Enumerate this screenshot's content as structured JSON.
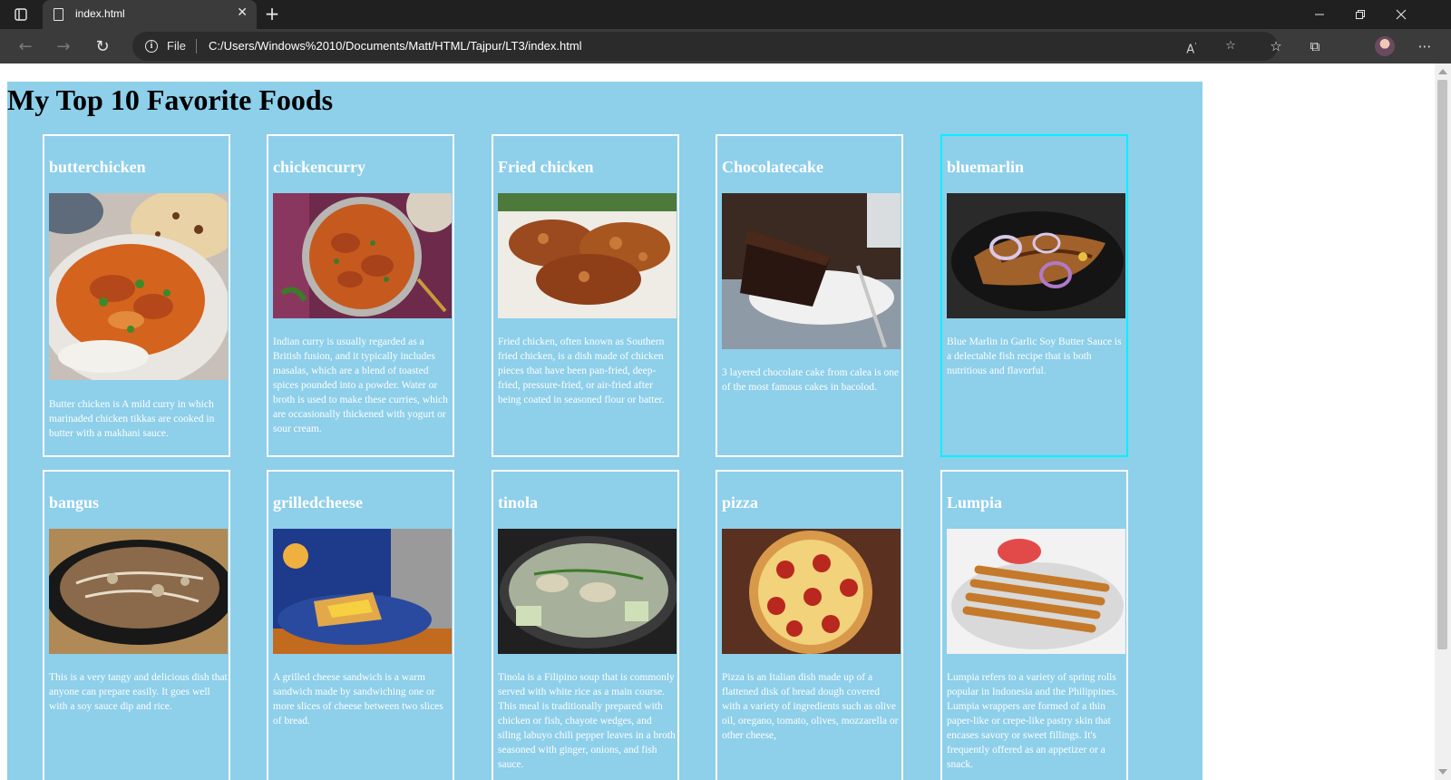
{
  "browser": {
    "tab_title": "index.html",
    "address_scheme": "File",
    "url": "C:/Users/Windows%2010/Documents/Matt/HTML/Tajpur/LT3/index.html"
  },
  "page": {
    "title": "My Top 10 Favorite Foods",
    "foods": [
      {
        "name": "butterchicken",
        "description": "Butter chicken is A mild curry in which marinaded chicken tikkas are cooked in butter with a makhani sauce."
      },
      {
        "name": "chickencurry",
        "description": "Indian curry is usually regarded as a British fusion, and it typically includes masalas, which are a blend of toasted spices pounded into a powder. Water or broth is used to make these curries, which are occasionally thickened with yogurt or sour cream."
      },
      {
        "name": "Fried chicken",
        "description": "Fried chicken, often known as Southern fried chicken, is a dish made of chicken pieces that have been pan-fried, deep-fried, pressure-fried, or air-fried after being coated in seasoned flour or batter."
      },
      {
        "name": "Chocolatecake",
        "description": "3 layered chocolate cake from calea is one of the most famous cakes in bacolod."
      },
      {
        "name": "bluemarlin",
        "description": "Blue Marlin in Garlic Soy Butter Sauce is a delectable fish recipe that is both nutritious and flavorful."
      },
      {
        "name": "bangus",
        "description": "This is a very tangy and delicious dish that anyone can prepare easily. It goes well with a soy sauce dip and rice."
      },
      {
        "name": "grilledcheese",
        "description": "A grilled cheese sandwich is a warm sandwich made by sandwiching one or more slices of cheese between two slices of bread."
      },
      {
        "name": "tinola",
        "description": "Tinola is a Filipino soup that is commonly served with white rice as a main course. This meal is traditionally prepared with chicken or fish, chayote wedges, and siling labuyo chili pepper leaves in a broth seasoned with ginger, onions, and fish sauce."
      },
      {
        "name": "pizza",
        "description": "Pizza is an Italian dish made up of a flattened disk of bread dough covered with a variety of ingredients such as olive oil, oregano, tomato, olives, mozzarella or other cheese,"
      },
      {
        "name": "Lumpia",
        "description": "Lumpia refers to a variety of spring rolls popular in Indonesia and the Philippines. Lumpia wrappers are formed of a thin paper-like or crepe-like pastry skin that encases savory or sweet fillings. It's frequently offered as an appetizer or a snack."
      }
    ]
  },
  "colors": {
    "page_background": "#8ecfea",
    "card_border": "#ffffff",
    "active_card_border": "#00f0ff"
  },
  "icons": [
    "tab-actions-icon",
    "document-icon",
    "close-icon",
    "new-tab-icon",
    "minimize-icon",
    "restore-icon",
    "window-close-icon",
    "back-icon",
    "forward-icon",
    "refresh-icon",
    "info-icon",
    "read-aloud-icon",
    "add-favorite-icon",
    "favorites-icon",
    "collections-icon",
    "profile-avatar",
    "more-icon"
  ]
}
